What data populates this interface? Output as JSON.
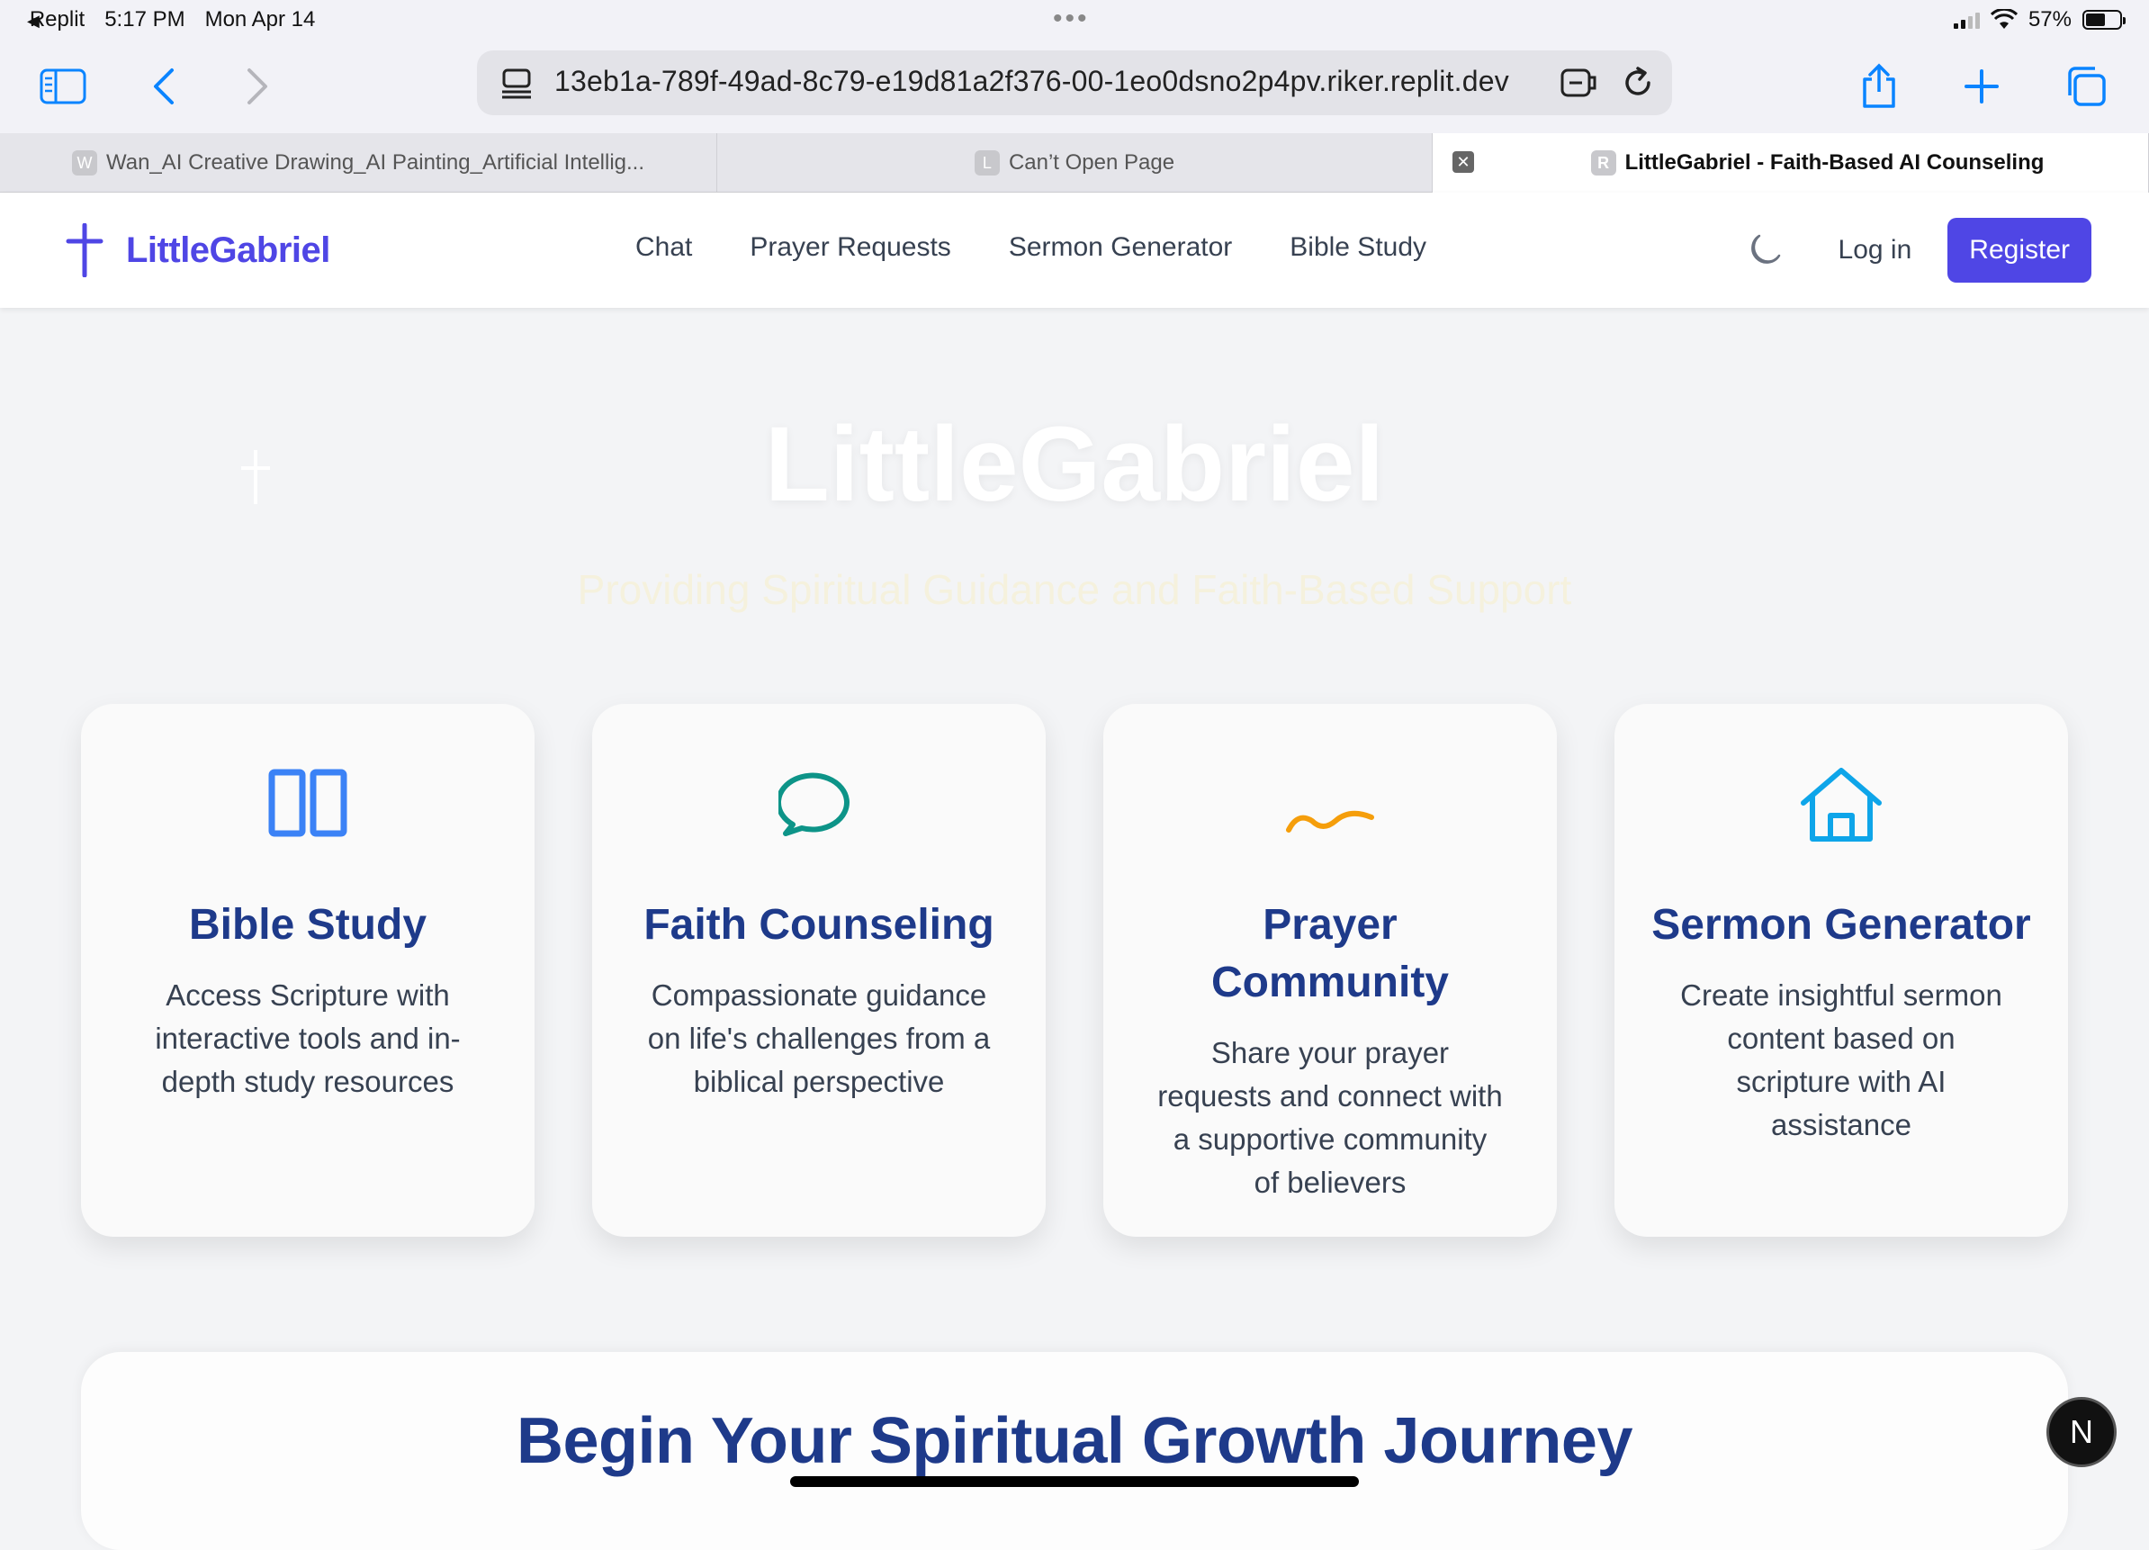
{
  "status_bar": {
    "back_app": "Replit",
    "time": "5:17 PM",
    "date": "Mon Apr 14",
    "battery": "57%",
    "battery_level": 0.57
  },
  "browser": {
    "url": "13eb1a-789f-49ad-8c79-e19d81a2f376-00-1eo0dsno2p4pv.riker.replit.dev",
    "tabs": [
      {
        "favicon": "W",
        "title": "Wan_AI Creative Drawing_AI Painting_Artificial Intellig..."
      },
      {
        "favicon": "L",
        "title": "Can’t Open Page"
      },
      {
        "favicon": "R",
        "title": "LittleGabriel - Faith-Based AI Counseling",
        "active": true
      }
    ]
  },
  "header": {
    "brand": "LittleGabriel",
    "nav": [
      "Chat",
      "Prayer Requests",
      "Sermon Generator",
      "Bible Study"
    ],
    "login": "Log in",
    "register": "Register"
  },
  "hero": {
    "title": "LittleGabriel",
    "subtitle": "Providing Spiritual Guidance and Faith-Based Support"
  },
  "features": [
    {
      "icon": "book-icon",
      "color": "#3b82f6",
      "title": "Bible Study",
      "text": "Access Scripture with interactive tools and in-depth study resources"
    },
    {
      "icon": "chat-bubble-icon",
      "color": "#0d9488",
      "title": "Faith Counseling",
      "text": "Compassionate guidance on life's challenges from a biblical perspective"
    },
    {
      "icon": "praying-hands-icon",
      "color": "#f59e0b",
      "title": "Prayer Community",
      "text": "Share your prayer requests and connect with a supportive community of believers"
    },
    {
      "icon": "church-icon",
      "color": "#0ea5e9",
      "title": "Sermon Generator",
      "text": "Create insightful sermon content based on scripture with AI assistance"
    }
  ],
  "journey": {
    "title": "Begin Your Spiritual Growth Journey"
  },
  "floating_badge": "N",
  "colors": {
    "brand": "#4f46e5",
    "heading": "#1e3a8a",
    "page_bg": "#f3f4f6"
  }
}
